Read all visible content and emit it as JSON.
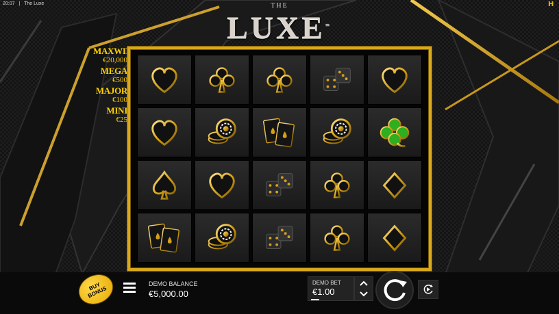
{
  "status_bar": {
    "time": "20:07",
    "separator": "|",
    "app_name": "The Luxe"
  },
  "logo": {
    "small": "THE",
    "main": "LUXE",
    "mark": "™"
  },
  "corner_icon": "H",
  "jackpots": [
    {
      "name": "MAXWIN",
      "value": "€20,000"
    },
    {
      "name": "MEGA",
      "value": "€500"
    },
    {
      "name": "MAJOR",
      "value": "€100"
    },
    {
      "name": "MINI",
      "value": "€25"
    }
  ],
  "reels": [
    [
      "heart",
      "club",
      "club",
      "dice",
      "heart"
    ],
    [
      "heart",
      "chips",
      "aces",
      "chips",
      "clover"
    ],
    [
      "spade",
      "heart",
      "dice",
      "club",
      "diamond"
    ],
    [
      "aces",
      "chips",
      "dice",
      "club",
      "diamond"
    ]
  ],
  "buy_bonus": {
    "line1": "BUY",
    "line2": "BONUS"
  },
  "balance": {
    "label": "DEMO BALANCE",
    "value": "€5,000.00"
  },
  "bet": {
    "label": "DEMO BET",
    "value": "€1.00"
  },
  "icons": {
    "menu": "menu-icon",
    "spin": "spin-icon",
    "autoplay": "autoplay-icon",
    "bet_up": "chevron-up-icon",
    "bet_down": "chevron-down-icon"
  },
  "colors": {
    "gold": "#d9a91c",
    "jackpot": "#ffd200",
    "clover": "#2fae1f"
  }
}
